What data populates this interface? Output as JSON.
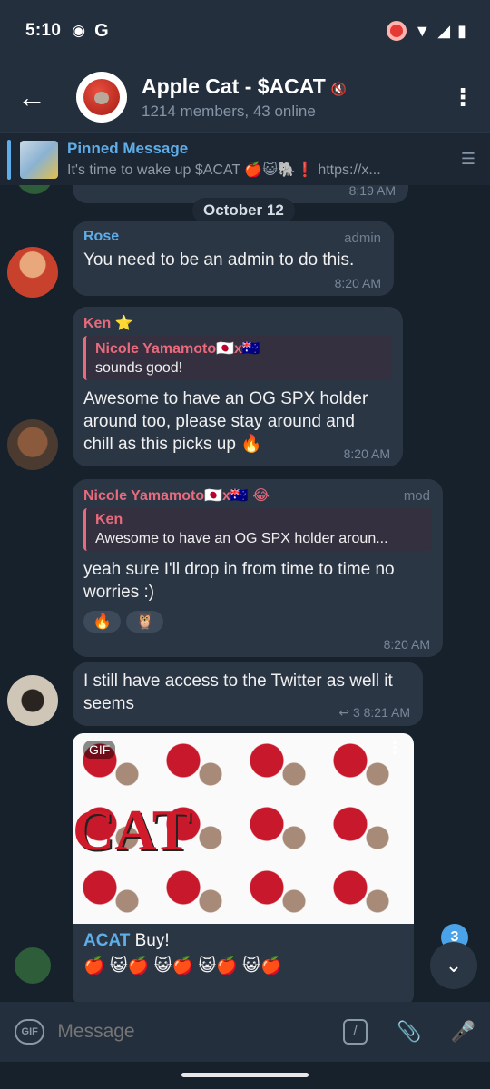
{
  "status": {
    "time": "5:10",
    "carrier_icon": "G"
  },
  "header": {
    "back_icon": "←",
    "title": "Apple Cat - $ACAT",
    "subtitle": "1214 members, 43 online",
    "menu_icon": "⋮"
  },
  "pinned": {
    "label": "Pinned Message",
    "text": "It's time to wake up $ACAT 🍎😺🐘❗ https://x..."
  },
  "chat": {
    "prev_time": "8:19 AM",
    "date_header": "October 12",
    "messages": [
      {
        "sender": "Rose",
        "sender_color": "#5eaeea",
        "role": "admin",
        "text": "You need to be an admin to do this.",
        "time": "8:20 AM"
      },
      {
        "sender": "Ken ⭐",
        "sender_color": "#e86a7c",
        "reply_name": "Nicole Yamamoto🇯🇵x🇦🇺",
        "reply_text": "sounds good!",
        "text": "Awesome to have an OG SPX holder around too, please stay around and chill as this picks up 🔥",
        "time": "8:20 AM"
      },
      {
        "sender": "Nicole Yamamoto🇯🇵x🇦🇺 😂",
        "sender_color": "#e86a7c",
        "role": "mod",
        "reply_name": "Ken",
        "reply_text": "Awesome to have an OG SPX holder aroun...",
        "text": "yeah sure I'll drop in from time to time no worries :)",
        "reactions": [
          "🔥",
          "🦉"
        ],
        "time": "8:20 AM"
      },
      {
        "text": "I still have access to the Twitter as well it seems",
        "time": "↩ 3 8:21 AM"
      }
    ],
    "gif": {
      "label": "GIF",
      "overlay_text": "CAT",
      "caption_link": "ACAT",
      "caption_rest": " Buy!",
      "emoji_row": "🍎 😺🍎 😺🍎 😺🍎 😺🍎"
    }
  },
  "scroll": {
    "unread": "3",
    "icon": "⌄"
  },
  "input": {
    "gif_label": "GIF",
    "placeholder": "Message",
    "cmd_icon": "/",
    "attach_icon": "📎",
    "mic_icon": "🎤"
  }
}
